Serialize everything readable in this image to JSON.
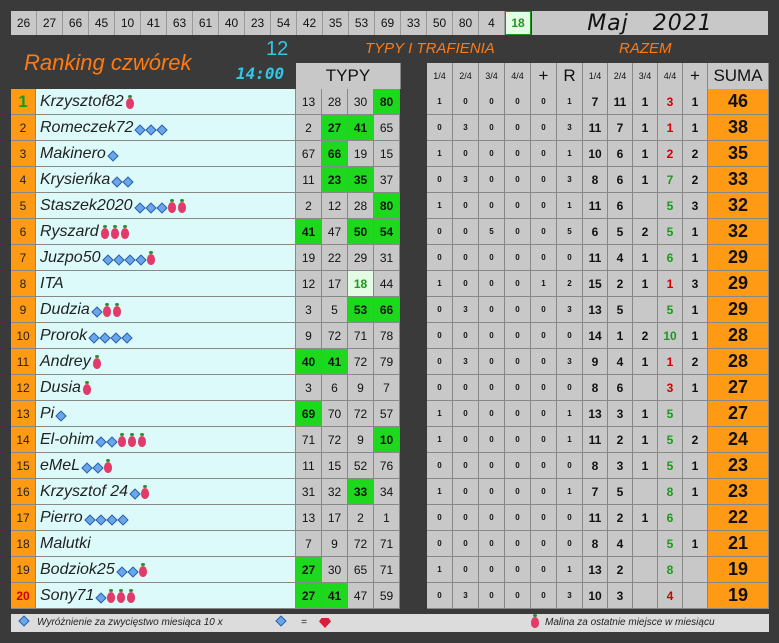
{
  "drawn_numbers": [
    "26",
    "27",
    "66",
    "45",
    "10",
    "41",
    "63",
    "61",
    "40",
    "23",
    "54",
    "42",
    "35",
    "53",
    "69",
    "33",
    "50",
    "80",
    "4",
    "18"
  ],
  "month": {
    "name": "Maj",
    "year": "2021"
  },
  "title": "Ranking czwórek",
  "round": {
    "number": "12",
    "time": "14:00"
  },
  "headers": {
    "typy": "TYPY",
    "typy_i_trafienia": "TYPY I TRAFIENIA",
    "razem": "RAZEM",
    "cols_left": [
      "1/4",
      "2/4",
      "3/4",
      "4/4",
      "+",
      "R"
    ],
    "cols_right": [
      "1/4",
      "2/4",
      "3/4",
      "4/4",
      "+"
    ],
    "suma": "SUMA"
  },
  "rows": [
    {
      "rank": "1",
      "name": "Krzysztof82",
      "d": 0,
      "b": 1,
      "tips": [
        "13",
        "28",
        "30",
        "80"
      ],
      "hits": [
        3
      ],
      "s": [
        "1",
        "0",
        "0",
        "0",
        "0",
        "1"
      ],
      "r": [
        "7",
        "11",
        "1",
        "3",
        "1"
      ],
      "suma": "46"
    },
    {
      "rank": "2",
      "name": "Romeczek72",
      "d": 3,
      "b": 0,
      "tips": [
        "2",
        "27",
        "41",
        "65"
      ],
      "hits": [
        1,
        2
      ],
      "s": [
        "0",
        "3",
        "0",
        "0",
        "0",
        "3"
      ],
      "r": [
        "11",
        "7",
        "1",
        "1",
        "1"
      ],
      "suma": "38"
    },
    {
      "rank": "3",
      "name": "Makinero",
      "d": 1,
      "b": 0,
      "tips": [
        "67",
        "66",
        "19",
        "15"
      ],
      "hits": [
        1
      ],
      "s": [
        "1",
        "0",
        "0",
        "0",
        "0",
        "1"
      ],
      "r": [
        "10",
        "6",
        "1",
        "2",
        "2"
      ],
      "suma": "35"
    },
    {
      "rank": "4",
      "name": "Krysieńka",
      "d": 2,
      "b": 0,
      "tips": [
        "11",
        "23",
        "35",
        "37"
      ],
      "hits": [
        1,
        2
      ],
      "s": [
        "0",
        "3",
        "0",
        "0",
        "0",
        "3"
      ],
      "r": [
        "8",
        "6",
        "1",
        "7",
        "2"
      ],
      "suma": "33"
    },
    {
      "rank": "5",
      "name": "Staszek2020",
      "d": 3,
      "b": 2,
      "tips": [
        "2",
        "12",
        "28",
        "80"
      ],
      "hits": [
        3
      ],
      "s": [
        "1",
        "0",
        "0",
        "0",
        "0",
        "1"
      ],
      "r": [
        "11",
        "6",
        "",
        "5",
        "3"
      ],
      "suma": "32"
    },
    {
      "rank": "6",
      "name": "Ryszard",
      "d": 0,
      "b": 3,
      "tips": [
        "41",
        "47",
        "50",
        "54"
      ],
      "hits": [
        0,
        2,
        3
      ],
      "s": [
        "0",
        "0",
        "5",
        "0",
        "0",
        "5"
      ],
      "r": [
        "6",
        "5",
        "2",
        "5",
        "1"
      ],
      "suma": "32"
    },
    {
      "rank": "7",
      "name": "Juzpo50",
      "d": 4,
      "b": 1,
      "tips": [
        "19",
        "22",
        "29",
        "31"
      ],
      "hits": [],
      "s": [
        "0",
        "0",
        "0",
        "0",
        "0",
        "0"
      ],
      "r": [
        "11",
        "4",
        "1",
        "6",
        "1"
      ],
      "suma": "29"
    },
    {
      "rank": "8",
      "name": "ITA",
      "d": 0,
      "b": 0,
      "tips": [
        "12",
        "17",
        "18",
        "44"
      ],
      "soft": [
        2
      ],
      "s": [
        "1",
        "0",
        "0",
        "0",
        "1",
        "2"
      ],
      "r": [
        "15",
        "2",
        "1",
        "1",
        "3"
      ],
      "suma": "29"
    },
    {
      "rank": "9",
      "name": "Dudzia",
      "d": 1,
      "b": 2,
      "tips": [
        "3",
        "5",
        "53",
        "66"
      ],
      "hits": [
        2,
        3
      ],
      "s": [
        "0",
        "3",
        "0",
        "0",
        "0",
        "3"
      ],
      "r": [
        "13",
        "5",
        "",
        "5",
        "1"
      ],
      "suma": "29"
    },
    {
      "rank": "10",
      "name": "Prorok",
      "d": 4,
      "b": 0,
      "tips": [
        "9",
        "72",
        "71",
        "78"
      ],
      "hits": [],
      "s": [
        "0",
        "0",
        "0",
        "0",
        "0",
        "0"
      ],
      "r": [
        "14",
        "1",
        "2",
        "10",
        "1"
      ],
      "suma": "28"
    },
    {
      "rank": "11",
      "name": "Andrey",
      "d": 0,
      "b": 1,
      "tips": [
        "40",
        "41",
        "72",
        "79"
      ],
      "hits": [
        0,
        1
      ],
      "s": [
        "0",
        "3",
        "0",
        "0",
        "0",
        "3"
      ],
      "r": [
        "9",
        "4",
        "1",
        "1",
        "2"
      ],
      "suma": "28"
    },
    {
      "rank": "12",
      "name": "Dusia",
      "d": 0,
      "b": 1,
      "tips": [
        "3",
        "6",
        "9",
        "7"
      ],
      "hits": [],
      "s": [
        "0",
        "0",
        "0",
        "0",
        "0",
        "0"
      ],
      "r": [
        "8",
        "6",
        "",
        "3",
        "1"
      ],
      "suma": "27"
    },
    {
      "rank": "13",
      "name": "Pi",
      "d": 1,
      "b": 0,
      "tips": [
        "69",
        "70",
        "72",
        "57"
      ],
      "hits": [
        0
      ],
      "s": [
        "1",
        "0",
        "0",
        "0",
        "0",
        "1"
      ],
      "r": [
        "13",
        "3",
        "1",
        "5",
        ""
      ],
      "suma": "27"
    },
    {
      "rank": "14",
      "name": "El-ohim",
      "d": 2,
      "b": 3,
      "tips": [
        "71",
        "72",
        "9",
        "10"
      ],
      "hits": [
        3
      ],
      "s": [
        "1",
        "0",
        "0",
        "0",
        "0",
        "1"
      ],
      "r": [
        "11",
        "2",
        "1",
        "5",
        "2"
      ],
      "suma": "24"
    },
    {
      "rank": "15",
      "name": "eMeL",
      "d": 2,
      "b": 1,
      "tips": [
        "11",
        "15",
        "52",
        "76"
      ],
      "hits": [],
      "s": [
        "0",
        "0",
        "0",
        "0",
        "0",
        "0"
      ],
      "r": [
        "8",
        "3",
        "1",
        "5",
        "1"
      ],
      "suma": "23"
    },
    {
      "rank": "16",
      "name": "Krzysztof 24",
      "d": 1,
      "b": 1,
      "tips": [
        "31",
        "32",
        "33",
        "34"
      ],
      "hits": [
        2
      ],
      "s": [
        "1",
        "0",
        "0",
        "0",
        "0",
        "1"
      ],
      "r": [
        "7",
        "5",
        "",
        "8",
        "1"
      ],
      "suma": "23"
    },
    {
      "rank": "17",
      "name": "Pierro",
      "d": 4,
      "b": 0,
      "tips": [
        "13",
        "17",
        "2",
        "1"
      ],
      "hits": [],
      "s": [
        "0",
        "0",
        "0",
        "0",
        "0",
        "0"
      ],
      "r": [
        "11",
        "2",
        "1",
        "6",
        ""
      ],
      "suma": "22"
    },
    {
      "rank": "18",
      "name": "Malutki",
      "d": 0,
      "b": 0,
      "tips": [
        "7",
        "9",
        "72",
        "71"
      ],
      "hits": [],
      "s": [
        "0",
        "0",
        "0",
        "0",
        "0",
        "0"
      ],
      "r": [
        "8",
        "4",
        "",
        "5",
        "1"
      ],
      "suma": "21"
    },
    {
      "rank": "19",
      "name": "Bodziok25",
      "d": 2,
      "b": 1,
      "tips": [
        "27",
        "30",
        "65",
        "71"
      ],
      "hits": [
        0
      ],
      "s": [
        "1",
        "0",
        "0",
        "0",
        "0",
        "1"
      ],
      "r": [
        "13",
        "2",
        "",
        "8",
        ""
      ],
      "suma": "19"
    },
    {
      "rank": "20",
      "name": "Sony71",
      "d": 1,
      "b": 3,
      "tips": [
        "27",
        "41",
        "47",
        "59"
      ],
      "hits": [
        0,
        1
      ],
      "s": [
        "0",
        "3",
        "0",
        "0",
        "0",
        "3"
      ],
      "r": [
        "10",
        "3",
        "",
        "4",
        ""
      ],
      "suma": "19"
    }
  ],
  "footer": {
    "left": "Wyróżnienie za zwycięstwo miesiąca  10 x",
    "eq": "=",
    "right": "Malina za ostatnie miejsce w miesiącu"
  },
  "colors": {
    "orange": "#ff9a14",
    "hit": "#1ed81e",
    "name_bg": "#dcfafa",
    "title": "#ff7a14",
    "cyan": "#30c8e6"
  }
}
